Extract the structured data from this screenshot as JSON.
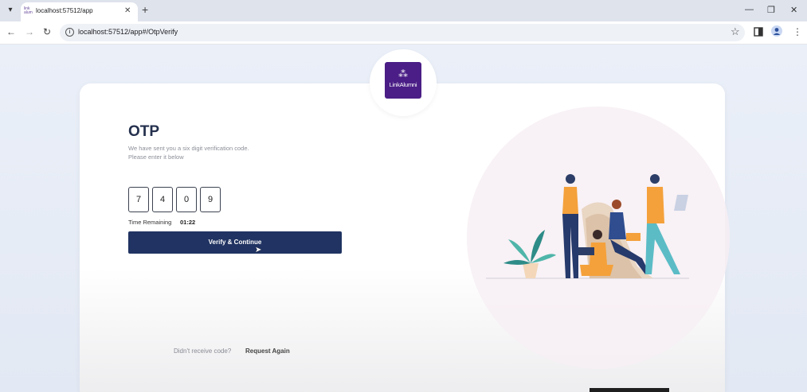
{
  "browser": {
    "tab_title": "localhost:57512/app",
    "favicon_text": "link alum",
    "url": "localhost:57512/app#/OtpVerify"
  },
  "logo": {
    "mark": "⁂",
    "text": "LinkAlumni"
  },
  "otp": {
    "title": "OTP",
    "subtitle": "We have sent you a six digit verification code. Please enter it below",
    "digits": [
      "7",
      "4",
      "0",
      "9"
    ],
    "time_label": "Time Remaining",
    "time_value": "01:22",
    "verify_label": "Verify & Continue",
    "resend_prompt": "Didn't receive code?",
    "resend_link": "Request Again"
  },
  "colors": {
    "primary": "#203362",
    "logo_bg": "#4a1e86"
  }
}
